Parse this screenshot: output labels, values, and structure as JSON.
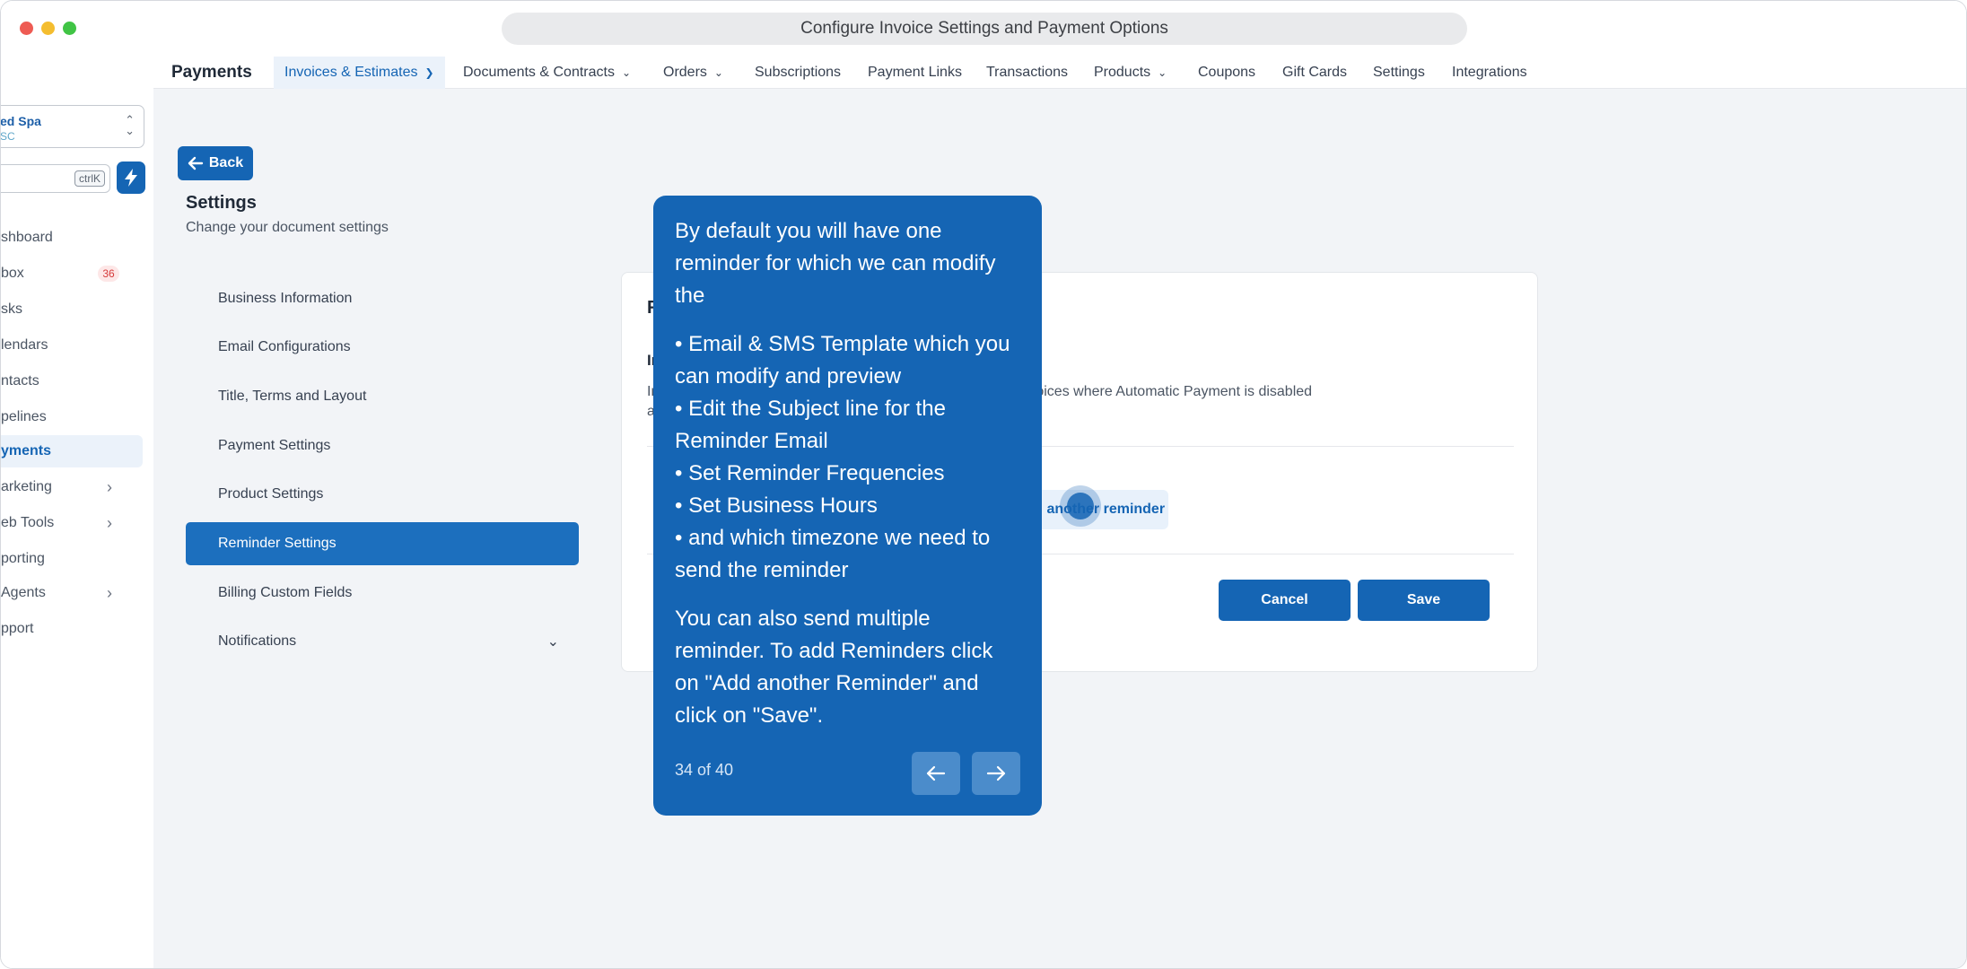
{
  "window": {
    "title": "Configure Invoice Settings and Payment Options"
  },
  "sidebar": {
    "location": {
      "name": "ed Spa",
      "sub": "SC"
    },
    "search_kbd": "ctrlK",
    "items": [
      {
        "label": "shboard"
      },
      {
        "label": "box",
        "badge": "36"
      },
      {
        "label": "sks"
      },
      {
        "label": "lendars"
      },
      {
        "label": "ntacts"
      },
      {
        "label": "pelines"
      },
      {
        "label": "yments",
        "active": true
      },
      {
        "label": "arketing",
        "has_children": true
      },
      {
        "label": "eb Tools",
        "has_children": true
      },
      {
        "label": "porting"
      },
      {
        "label": "Agents",
        "has_children": true
      },
      {
        "label": "pport"
      }
    ]
  },
  "topnav": {
    "brand": "Payments",
    "tabs": [
      {
        "label": "Invoices & Estimates",
        "active": true,
        "dropdown": true
      },
      {
        "label": "Documents & Contracts",
        "dropdown": true
      },
      {
        "label": "Orders",
        "dropdown": true
      },
      {
        "label": "Subscriptions"
      },
      {
        "label": "Payment Links"
      },
      {
        "label": "Transactions"
      },
      {
        "label": "Products",
        "dropdown": true
      },
      {
        "label": "Coupons"
      },
      {
        "label": "Gift Cards"
      },
      {
        "label": "Settings"
      },
      {
        "label": "Integrations"
      }
    ]
  },
  "page": {
    "back_label": "Back",
    "title": "Settings",
    "subtitle": "Change your document settings",
    "menu": [
      {
        "label": "Business Information"
      },
      {
        "label": "Email Configurations"
      },
      {
        "label": "Title, Terms and Layout"
      },
      {
        "label": "Payment Settings"
      },
      {
        "label": "Product Settings"
      },
      {
        "label": "Reminder Settings",
        "active": true
      },
      {
        "label": "Billing Custom Fields"
      },
      {
        "label": "Notifications",
        "expandable": true
      }
    ]
  },
  "card": {
    "title": "R",
    "heading": "In",
    "desc_visible": "voices where Automatic Payment is disabled",
    "desc_prefix": "In",
    "desc2": "a",
    "add_reminder_label": "Add another reminder",
    "cancel_label": "Cancel",
    "save_label": "Save"
  },
  "tour": {
    "intro": "By default you will have one reminder for which we can modify the",
    "bullets": [
      "• Email & SMS Template which you can modify and preview",
      "• Edit the Subject line for the Reminder Email",
      "• Set Reminder Frequencies",
      "• Set Business Hours",
      "• and which timezone we need to send the reminder"
    ],
    "outro": "You can also send multiple reminder. To add Reminders click on \"Add another Reminder\" and click on \"Save\".",
    "progress": "34 of 40"
  },
  "colors": {
    "accent": "#1565b4",
    "tour_bg": "#1565b4",
    "active_menu": "#1c6fbe",
    "badge_bg": "#fde7e7",
    "badge_text": "#d63b3b"
  }
}
